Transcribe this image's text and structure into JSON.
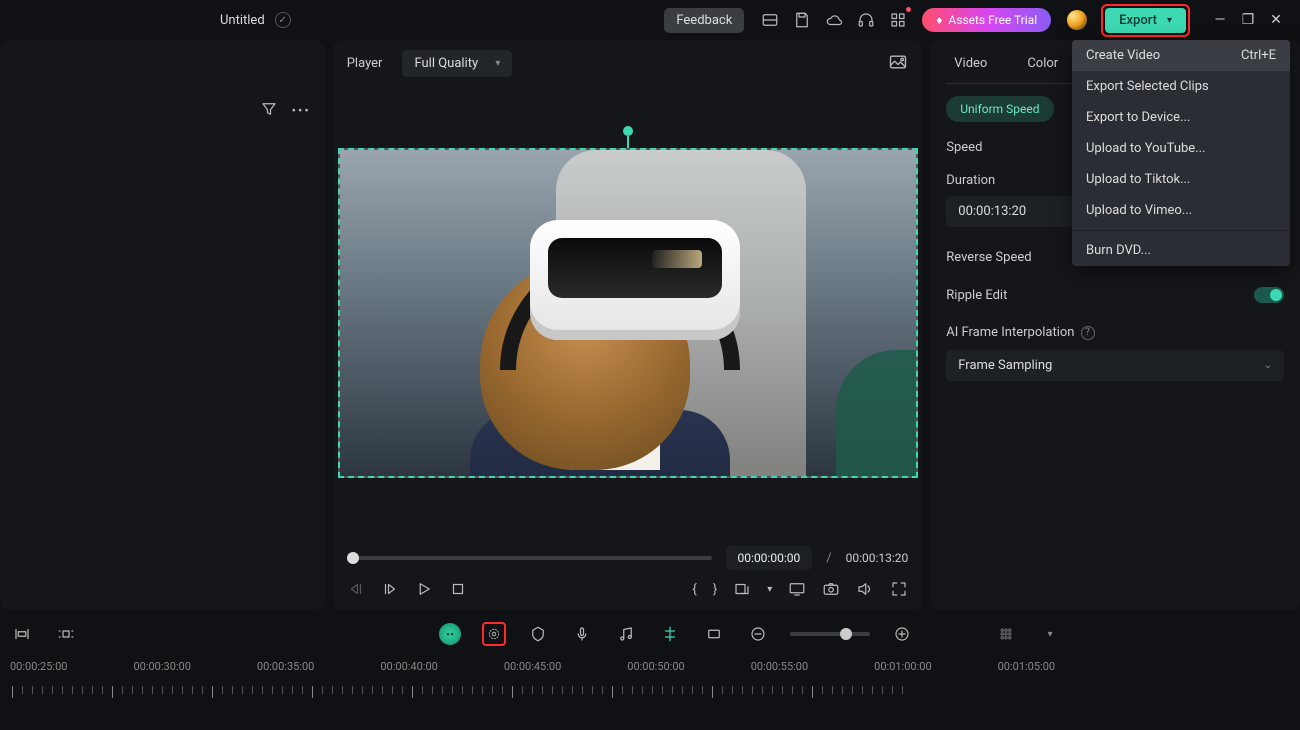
{
  "titlebar": {
    "title": "Untitled",
    "feedback": "Feedback",
    "assets": "Assets Free Trial",
    "export": "Export"
  },
  "export_menu": {
    "create_video": "Create Video",
    "create_video_shortcut": "Ctrl+E",
    "export_selected": "Export Selected Clips",
    "export_device": "Export to Device...",
    "upload_youtube": "Upload to YouTube...",
    "upload_tiktok": "Upload to Tiktok...",
    "upload_vimeo": "Upload to Vimeo...",
    "burn_dvd": "Burn DVD..."
  },
  "player": {
    "label": "Player",
    "quality": "Full Quality",
    "current_time": "00:00:00:00",
    "separator": "/",
    "duration": "00:00:13:20"
  },
  "properties": {
    "tab_video": "Video",
    "tab_color": "Color",
    "uniform_speed": "Uniform Speed",
    "speed_label": "Speed",
    "duration_label": "Duration",
    "duration_value": "00:00:13:20",
    "reverse_speed": "Reverse Speed",
    "ripple_edit": "Ripple Edit",
    "ai_frame": "AI Frame Interpolation",
    "frame_sampling": "Frame Sampling"
  },
  "timeline": {
    "labels": [
      "00:00:25:00",
      "00:00:30:00",
      "00:00:35:00",
      "00:00:40:00",
      "00:00:45:00",
      "00:00:50:00",
      "00:00:55:00",
      "00:01:00:00",
      "00:01:05:00"
    ]
  }
}
